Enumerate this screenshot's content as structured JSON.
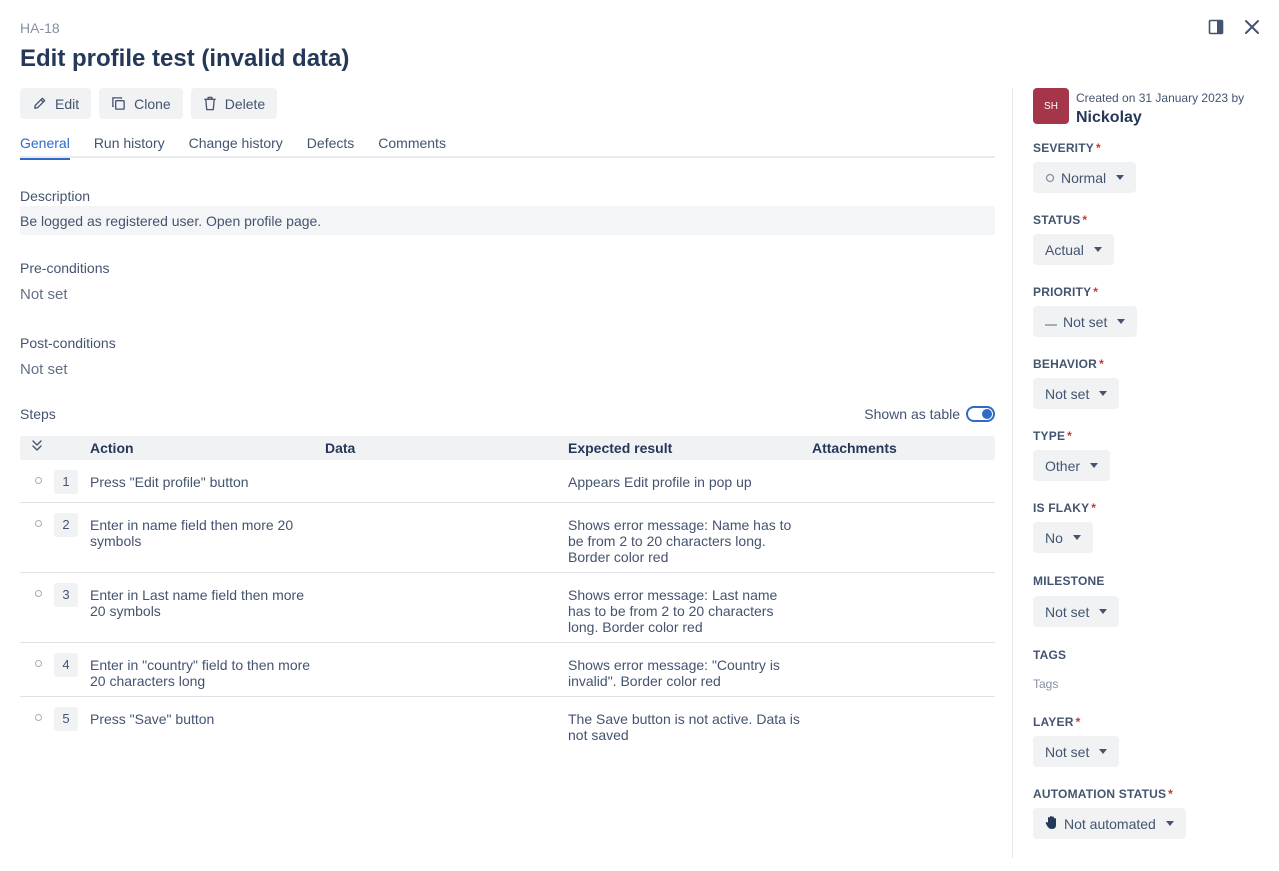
{
  "header": {
    "key": "HA-18",
    "title": "Edit profile test (invalid data)"
  },
  "toolbar": {
    "edit_label": "Edit",
    "clone_label": "Clone",
    "delete_label": "Delete"
  },
  "tabs": [
    {
      "label": "General",
      "active": true
    },
    {
      "label": "Run history",
      "active": false
    },
    {
      "label": "Change history",
      "active": false
    },
    {
      "label": "Defects",
      "active": false
    },
    {
      "label": "Comments",
      "active": false
    }
  ],
  "general": {
    "description_label": "Description",
    "description_value": "Be logged as registered user. Open profile page.",
    "preconditions_label": "Pre-conditions",
    "preconditions_value": "Not set",
    "postconditions_label": "Post-conditions",
    "postconditions_value": "Not set"
  },
  "steps": {
    "label": "Steps",
    "shown_as_table_label": "Shown as table",
    "shown_as_table_on": true,
    "columns": {
      "action": "Action",
      "data": "Data",
      "expected": "Expected result",
      "attachments": "Attachments"
    },
    "rows": [
      {
        "num": "1",
        "action": "Press \"Edit profile\" button",
        "data": "",
        "expected": "Appears Edit profile in pop up"
      },
      {
        "num": "2",
        "action": "Enter in name field then more 20 symbols",
        "data": "",
        "expected": "Shows error message: Name has to be from 2 to 20 characters long. Border color red"
      },
      {
        "num": "3",
        "action": "Enter in Last name field then more 20 symbols",
        "data": "",
        "expected": "Shows error message: Last name has to be from 2 to 20 characters long. Border color red"
      },
      {
        "num": "4",
        "action": "Enter in \"country\" field to then more 20 characters long",
        "data": "",
        "expected": "Shows error message: \"Country is invalid\". Border color red"
      },
      {
        "num": "5",
        "action": "Press \"Save\" button",
        "data": "",
        "expected": "The Save button is not active. Data is not saved"
      }
    ]
  },
  "sidebar": {
    "avatar_initials": "SH",
    "avatar_color": "#a5364a",
    "created_text": "Created on 31 January 2023 by",
    "creator_name": "Nickolay",
    "severity": {
      "label": "SEVERITY",
      "value": "Normal",
      "icon": "circle-outline-icon"
    },
    "status": {
      "label": "STATUS",
      "value": "Actual"
    },
    "priority": {
      "label": "PRIORITY",
      "value": "Not set",
      "icon": "dash-icon"
    },
    "behavior": {
      "label": "BEHAVIOR",
      "value": "Not set"
    },
    "type": {
      "label": "TYPE",
      "value": "Other"
    },
    "is_flaky": {
      "label": "IS FLAKY",
      "value": "No"
    },
    "milestone": {
      "label": "MILESTONE",
      "value": "Not set"
    },
    "tags": {
      "label": "TAGS",
      "placeholder": "Tags"
    },
    "layer": {
      "label": "LAYER",
      "value": "Not set"
    },
    "automation_status": {
      "label": "AUTOMATION STATUS",
      "value": "Not automated",
      "icon": "hand-icon"
    }
  },
  "colors": {
    "accent": "#2f6bc7",
    "required": "#c9372c"
  }
}
